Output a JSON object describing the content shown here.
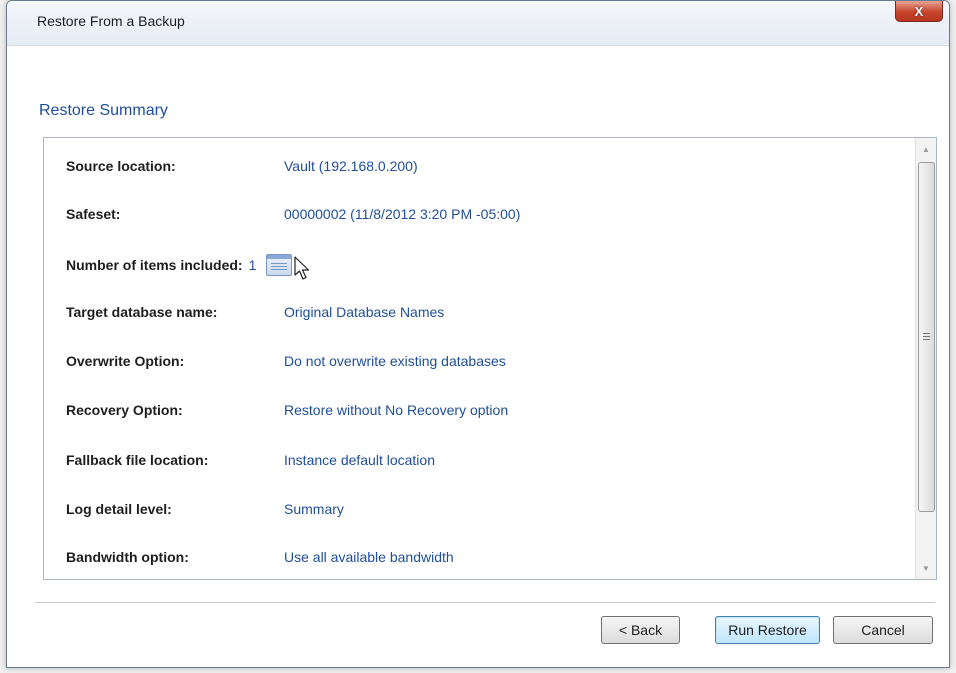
{
  "window": {
    "title": "Restore From a Backup",
    "close_label": "X"
  },
  "section_title": "Restore Summary",
  "summary": {
    "source_location": {
      "label": "Source location:",
      "value": "Vault (192.168.0.200)"
    },
    "safeset": {
      "label": "Safeset:",
      "value": "00000002 (11/8/2012 3:20 PM -05:00)"
    },
    "items_included": {
      "label": "Number of items included:",
      "value": "1",
      "icon": "list-view-icon"
    },
    "target_database": {
      "label": "Target database name:",
      "value": "Original Database Names"
    },
    "overwrite_option": {
      "label": "Overwrite Option:",
      "value": "Do not overwrite existing databases"
    },
    "recovery_option": {
      "label": "Recovery Option:",
      "value": "Restore without No Recovery option"
    },
    "fallback_location": {
      "label": "Fallback file location:",
      "value": "Instance default location"
    },
    "log_detail": {
      "label": "Log detail level:",
      "value": "Summary"
    },
    "bandwidth_option": {
      "label": "Bandwidth option:",
      "value": "Use all available bandwidth"
    }
  },
  "buttons": {
    "back": "< Back",
    "run_restore": "Run Restore",
    "cancel": "Cancel"
  },
  "colors": {
    "accent": "#1f4e9a",
    "close_button": "#c7442b"
  }
}
